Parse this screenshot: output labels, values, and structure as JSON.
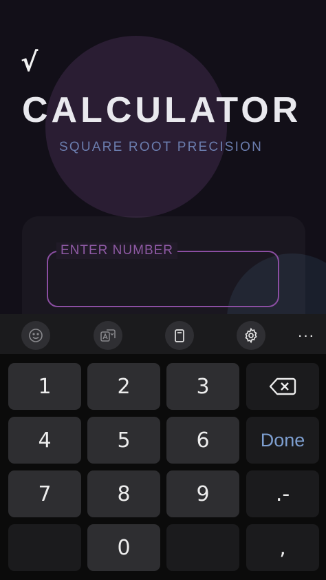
{
  "app": {
    "logo": "√",
    "title": "CALCULATOR",
    "subtitle": "SQUARE ROOT PRECISION",
    "input": {
      "label": "ENTER NUMBER",
      "value": "",
      "placeholder": ""
    }
  },
  "keyboard": {
    "toolbar": {
      "items": [
        "emoji-icon",
        "translate-icon",
        "clipboard-icon",
        "settings-icon"
      ],
      "more": "···"
    },
    "keys": {
      "k1": "1",
      "k2": "2",
      "k3": "3",
      "k4": "4",
      "k5": "5",
      "k6": "6",
      "k7": "7",
      "k8": "8",
      "k9": "9",
      "k0": "0",
      "done": "Done",
      "dot_minus": ".-",
      "comma": ","
    }
  },
  "colors": {
    "accent_purple": "#8b4ea2",
    "subtitle_blue": "#6b7dae",
    "done_blue": "#7e9fd0"
  }
}
